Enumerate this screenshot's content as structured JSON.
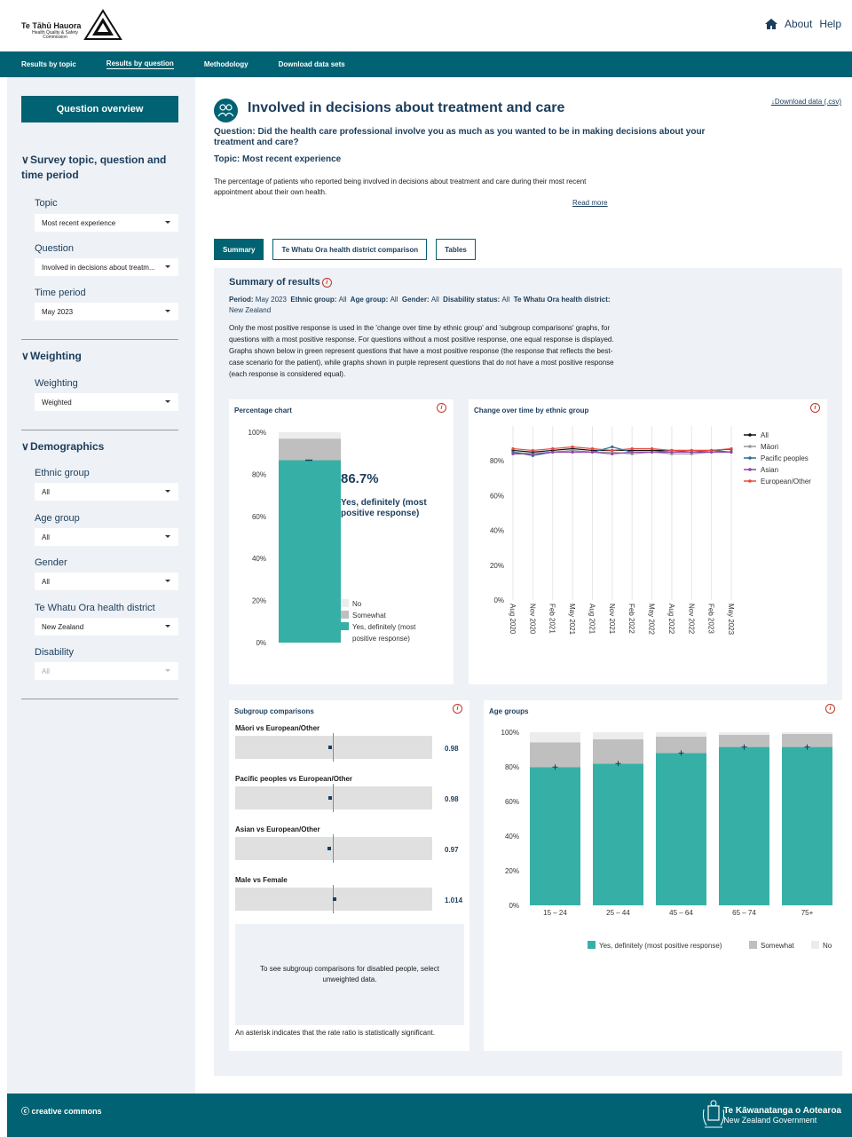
{
  "brand": {
    "name": "Te Tāhū Hauora",
    "sub": "Health Quality & Safety Commission"
  },
  "top_links": {
    "about": "About",
    "help": "Help"
  },
  "nav": [
    "Results by topic",
    "Results by question",
    "Methodology",
    "Download data sets"
  ],
  "sidebar": {
    "overview_button": "Question overview",
    "section1": "Survey topic, question and time period",
    "topic_label": "Topic",
    "topic_value": "Most recent experience",
    "question_label": "Question",
    "question_value": "Involved in decisions about treatm...",
    "time_label": "Time period",
    "time_value": "May 2023",
    "weighting_section": "Weighting",
    "weighting_label": "Weighting",
    "weighting_value": "Weighted",
    "demographics_section": "Demographics",
    "ethnic_label": "Ethnic group",
    "ethnic_value": "All",
    "age_label": "Age group",
    "age_value": "All",
    "gender_label": "Gender",
    "gender_value": "All",
    "district_label": "Te Whatu Ora health district",
    "district_value": "New Zealand",
    "disability_label": "Disability",
    "disability_value": "All"
  },
  "main": {
    "title": "Involved in decisions about treatment and care",
    "download": "↓Download data (.csv)",
    "question": "Question: Did the health care professional involve you as much as you wanted to be in making decisions about your treatment and care?",
    "topic": "Topic: Most recent experience",
    "description": "The percentage of patients who reported being involved in decisions about treatment and care during their most recent appointment about their own health.",
    "read_more": "Read more",
    "tabs": [
      "Summary",
      "Te Whatu Ora health district comparison",
      "Tables"
    ]
  },
  "summary": {
    "heading": "Summary of results",
    "period_label": "Period:",
    "period_value": "May 2023",
    "ethnic_label": "Ethnic group:",
    "ethnic_value": "All",
    "age_label": "Age group:",
    "age_value": "All",
    "gender_label": "Gender:",
    "gender_value": "All",
    "disability_label": "Disability status:",
    "disability_value": "All",
    "district_label": "Te Whatu Ora health district:",
    "district_value": "New Zealand",
    "note": "Only the most positive response is used in the 'change over time by ethnic group' and 'subgroup comparisons' graphs, for questions with a most positive response. For questions without a most positive response, one equal response is displayed. Graphs shown below in green represent questions that have a most positive response (the response that reflects the best-case scenario for the patient), while graphs shown in purple represent questions that do not have a most positive response (each response is considered equal)."
  },
  "colors": {
    "teal": "#36b0a6",
    "somewhat": "#bfbfbf",
    "no": "#ececec",
    "nav": "#006272",
    "title": "#1b3d5c"
  },
  "chart_data": [
    {
      "type": "bar",
      "title": "Percentage chart",
      "categories": [
        ""
      ],
      "series": [
        {
          "name": "Yes, definitely (most positive response)",
          "values": [
            86.7
          ]
        },
        {
          "name": "Somewhat",
          "values": [
            10.3
          ]
        },
        {
          "name": "No",
          "values": [
            3.0
          ]
        }
      ],
      "headline": "86.7%",
      "headline_label": "Yes, definitely (most positive response)",
      "legend": [
        "No",
        "Somewhat",
        "Yes, definitely (most positive response)"
      ],
      "yticks": [
        "0%",
        "20%",
        "40%",
        "60%",
        "80%",
        "100%"
      ],
      "ylim": [
        0,
        100
      ]
    },
    {
      "type": "line",
      "title": "Change over time by ethnic group",
      "x": [
        "Aug 2020",
        "Nov 2020",
        "Feb 2021",
        "May 2021",
        "Aug 2021",
        "Nov 2021",
        "Feb 2022",
        "May 2022",
        "Aug 2022",
        "Nov 2022",
        "Feb 2023",
        "May 2023"
      ],
      "series": [
        {
          "name": "All",
          "color": "#111111",
          "values": [
            86,
            85,
            86,
            87,
            86,
            86,
            86,
            86,
            86,
            86,
            86,
            86.7
          ]
        },
        {
          "name": "Māori",
          "color": "#999999",
          "values": [
            85,
            84,
            85,
            86,
            85,
            85,
            84,
            85,
            84,
            84,
            85,
            85
          ]
        },
        {
          "name": "Pacific peoples",
          "color": "#2c6e8e",
          "values": [
            85,
            83,
            85,
            85,
            85,
            88,
            85,
            85,
            86,
            85,
            86,
            85
          ]
        },
        {
          "name": "Asian",
          "color": "#8e44ad",
          "values": [
            84,
            84,
            85,
            85,
            85,
            84,
            85,
            85,
            85,
            85,
            85,
            85
          ]
        },
        {
          "name": "European/Other",
          "color": "#e74c3c",
          "values": [
            87,
            86,
            87,
            88,
            87,
            86,
            87,
            87,
            86,
            86,
            86,
            87
          ]
        }
      ],
      "yticks": [
        "0%",
        "20%",
        "40%",
        "60%",
        "80%"
      ],
      "ylim": [
        0,
        100
      ]
    },
    {
      "type": "bar",
      "title": "Subgroup comparisons",
      "categories": [
        "Māori vs European/Other",
        "Pacific peoples vs European/Other",
        "Asian vs European/Other",
        "Male vs Female"
      ],
      "values": [
        0.98,
        0.98,
        0.97,
        1.014
      ],
      "value_labels": [
        "0.98",
        "0.98",
        "0.97",
        "1.014"
      ],
      "disabled_note": "To see subgroup comparisons for disabled people, select unweighted data.",
      "footnote": "An asterisk indicates that the rate ratio is statistically significant."
    },
    {
      "type": "bar",
      "title": "Age groups",
      "categories": [
        "15 – 24",
        "25 – 44",
        "45 – 64",
        "65 – 74",
        "75+"
      ],
      "series": [
        {
          "name": "Yes, definitely (most positive response)",
          "values": [
            79.9,
            81.9,
            88.0,
            91.5,
            91.5
          ]
        },
        {
          "name": "Somewhat",
          "values": [
            14.3,
            14.0,
            9.5,
            7.0,
            7.5
          ]
        },
        {
          "name": "No",
          "values": [
            5.8,
            4.1,
            2.5,
            1.5,
            1.0
          ]
        }
      ],
      "legend": [
        "Yes, definitely (most positive response)",
        "Somewhat",
        "No"
      ],
      "yticks": [
        "0%",
        "20%",
        "40%",
        "60%",
        "80%",
        "100%"
      ],
      "ylim": [
        0,
        100
      ]
    }
  ],
  "footer": {
    "cc": "creative commons",
    "gov1": "Te Kāwanatanga o Aotearoa",
    "gov2": "New Zealand Government"
  }
}
